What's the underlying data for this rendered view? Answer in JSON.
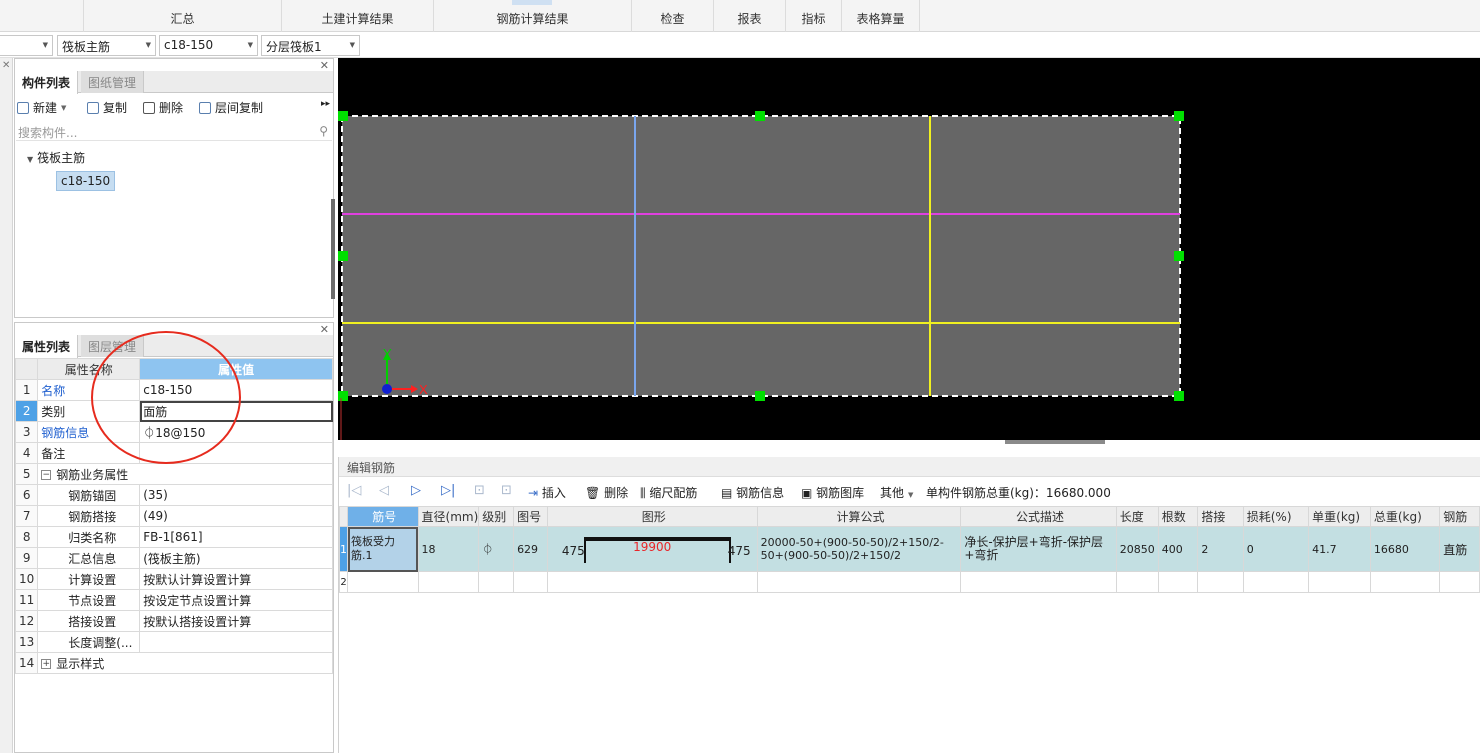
{
  "ribbon": {
    "tabs": [
      "汇总",
      "土建计算结果",
      "钢筋计算结果",
      "检查",
      "报表",
      "指标",
      "表格算量"
    ]
  },
  "combos": {
    "c0": "",
    "c1": "筏板主筋",
    "c2": "c18-150",
    "c3": "分层筏板1"
  },
  "component_panel": {
    "tabs": [
      "构件列表",
      "图纸管理"
    ],
    "tools": {
      "new": "新建",
      "copy": "复制",
      "delete": "删除",
      "floor_copy": "层间复制"
    },
    "search_placeholder": "搜索构件...",
    "tree": {
      "root": "筏板主筋",
      "leaf": "c18-150"
    }
  },
  "property_panel": {
    "tabs": [
      "属性列表",
      "图层管理"
    ],
    "header": {
      "name": "属性名称",
      "value": "属性值"
    },
    "rows": [
      {
        "n": "1",
        "name": "名称",
        "value": "c18-150"
      },
      {
        "n": "2",
        "name": "类别",
        "value": "面筋"
      },
      {
        "n": "3",
        "name": "钢筋信息",
        "value": "⏀18@150"
      },
      {
        "n": "4",
        "name": "备注",
        "value": ""
      },
      {
        "n": "5",
        "name": "钢筋业务属性",
        "value": ""
      },
      {
        "n": "6",
        "name": "钢筋锚固",
        "value": "(35)"
      },
      {
        "n": "7",
        "name": "钢筋搭接",
        "value": "(49)"
      },
      {
        "n": "8",
        "name": "归类名称",
        "value": "FB-1[861]"
      },
      {
        "n": "9",
        "name": "汇总信息",
        "value": "(筏板主筋)"
      },
      {
        "n": "10",
        "name": "计算设置",
        "value": "按默认计算设置计算"
      },
      {
        "n": "11",
        "name": "节点设置",
        "value": "按设定节点设置计算"
      },
      {
        "n": "12",
        "name": "搭接设置",
        "value": "按默认搭接设置计算"
      },
      {
        "n": "13",
        "name": "长度调整(...",
        "value": ""
      },
      {
        "n": "14",
        "name": "显示样式",
        "value": ""
      }
    ]
  },
  "canvas": {
    "axis_x": "X",
    "axis_y": "Y"
  },
  "editor": {
    "title": "编辑钢筋",
    "tools": {
      "insert": "插入",
      "delete": "删除",
      "scale": "缩尺配筋",
      "info": "钢筋信息",
      "library": "钢筋图库",
      "other": "其他"
    },
    "total_weight": "单构件钢筋总重(kg)：16680.000",
    "columns": [
      "筋号",
      "直径(mm)",
      "级别",
      "图号",
      "图形",
      "计算公式",
      "公式描述",
      "长度",
      "根数",
      "搭接",
      "损耗(%)",
      "单重(kg)",
      "总重(kg)",
      "钢筋"
    ],
    "row1": {
      "num": "1",
      "bar_no": "筏板受力筋.1",
      "diameter": "18",
      "grade": "⏀",
      "shape_no": "629",
      "shape_left": "475",
      "shape_mid": "19900",
      "shape_right": "475",
      "formula": "20000-50+(900-50-50)/2+150/2-50+(900-50-50)/2+150/2",
      "desc": "净长-保护层+弯折-保护层+弯折",
      "length": "20850",
      "count": "400",
      "lap": "2",
      "loss": "0",
      "unit_weight": "41.7",
      "total_weight": "16680",
      "type": "直筋"
    },
    "row2": {
      "num": "2"
    }
  },
  "colors": {
    "canvas_bg": "#000000",
    "slab_fill": "#666666",
    "magenta_line": "#e040e0",
    "yellow_line": "#f0f020",
    "blue_line": "#7aa6ee",
    "grip": "#00e000",
    "annotation_circle": "#e62b1e"
  }
}
